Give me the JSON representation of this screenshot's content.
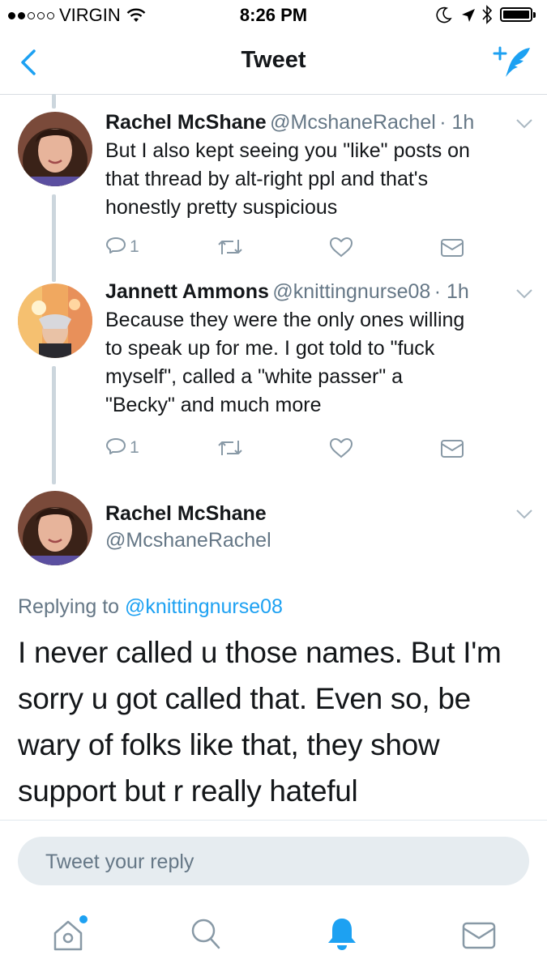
{
  "status_bar": {
    "carrier": "VIRGIN",
    "time": "8:26 PM",
    "signal_bars_filled": 2,
    "signal_bars_total": 5
  },
  "nav": {
    "title": "Tweet",
    "back_icon": "chevron-left-icon",
    "compose_icon": "compose-tweet-icon"
  },
  "tweets": [
    {
      "name": "Rachel McShane",
      "handle": "@McshaneRachel",
      "time": "· 1h",
      "lines": [
        "But I also kept seeing you \"like\" posts on",
        "that thread by alt-right ppl and that's",
        "honestly pretty suspicious"
      ],
      "reply_count": "1"
    },
    {
      "name": "Jannett Ammons",
      "handle": "@knittingnurse08",
      "time": "· 1h",
      "lines": [
        "Because they were the only ones willing",
        "to speak up for me.  I got told to \"fuck",
        "myself\", called a \"white passer\" a",
        "\"Becky\" and much more"
      ],
      "reply_count": "1"
    }
  ],
  "main_tweet": {
    "name": "Rachel McShane",
    "handle": "@McshaneRachel",
    "replying_to_label": "Replying to",
    "replying_to_handle": "@knittingnurse08",
    "lines": [
      "I never called u those names. But I'm",
      "sorry u got called that. Even so, be",
      "wary of folks like that, they show",
      "support but r really hateful"
    ]
  },
  "reply": {
    "placeholder": "Tweet your reply"
  },
  "tab_bar": [
    "home-icon",
    "search-icon",
    "notifications-icon",
    "messages-icon"
  ],
  "colors": {
    "accent": "#1da1f2",
    "text": "#14171a",
    "secondary": "#657786",
    "icon_gray": "#8899a6",
    "thread_line": "#ccd6dd"
  }
}
